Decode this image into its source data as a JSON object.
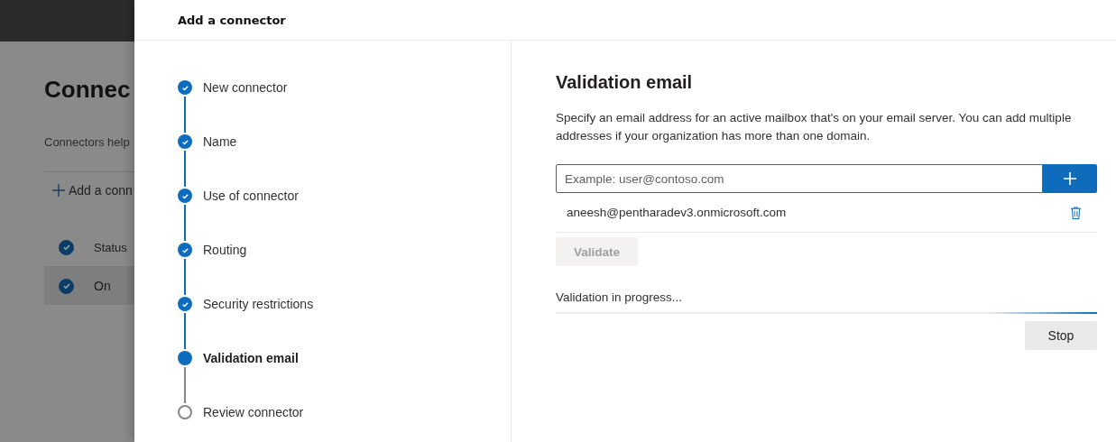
{
  "background_page": {
    "title": "Connec",
    "description": "Connectors help",
    "add_button": "Add a conn",
    "table": {
      "columns": [
        {
          "label": "Status",
          "checked": true
        }
      ],
      "rows": [
        {
          "status": "On",
          "checked": true,
          "selected": true
        }
      ]
    }
  },
  "panel": {
    "title": "Add a connector",
    "steps": [
      {
        "label": "New connector",
        "completed": true,
        "selected": false
      },
      {
        "label": "Name",
        "completed": true,
        "selected": false
      },
      {
        "label": "Use of connector",
        "completed": true,
        "selected": false
      },
      {
        "label": "Routing",
        "completed": true,
        "selected": false
      },
      {
        "label": "Security restrictions",
        "completed": true,
        "selected": false
      },
      {
        "label": "Validation email",
        "completed": false,
        "selected": true
      },
      {
        "label": "Review connector",
        "completed": false,
        "selected": false
      }
    ],
    "heading": "Validation email",
    "description": "Specify an email address for an active mailbox that's on your email server. You can add multiple addresses if your organization has more than one domain.",
    "email_field": {
      "placeholder": "Example: user@contoso.com"
    },
    "emails": [
      "aneesh@pentharadev3.onmicrosoft.com"
    ],
    "validate_button": {
      "label": "Validate",
      "disabled": true
    },
    "progress_label": "Validation in progress...",
    "progress": {
      "indeterminate": true
    },
    "stop_button": "Stop"
  }
}
